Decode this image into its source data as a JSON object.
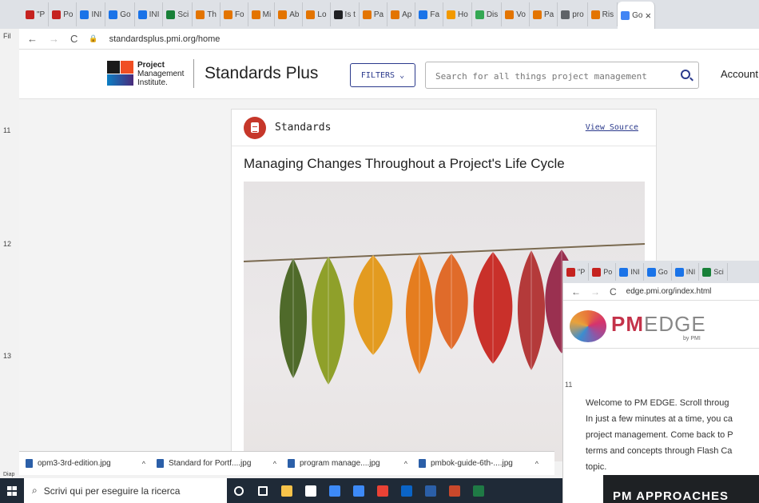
{
  "browser": {
    "url": "standardsplus.pmi.org/home",
    "tabs": [
      "\"P",
      "Po",
      "INI",
      "Go",
      "INI",
      "Sci",
      "Th",
      "Fo",
      "Mi",
      "Ab",
      "Lo",
      "Is t",
      "Pa",
      "Ap",
      "Fa",
      "Ho",
      "Dis",
      "Vo",
      "Pa",
      "pro",
      "Ris",
      "Go"
    ],
    "tab_colors": [
      "#c5221f",
      "#c5221f",
      "#1a73e8",
      "#1a73e8",
      "#1a73e8",
      "#188038",
      "#e37400",
      "#e37400",
      "#e37400",
      "#e37400",
      "#e37400",
      "#202124",
      "#e37400",
      "#e37400",
      "#1a73e8",
      "#f29900",
      "#34a853",
      "#e37400",
      "#e37400",
      "#5f6368",
      "#e37400",
      "#4285f4"
    ]
  },
  "left_labels": [
    "Fil",
    "11",
    "12",
    "13",
    "Diap"
  ],
  "header": {
    "logo_line1": "Project",
    "logo_line2": "Management",
    "logo_line3": "Institute.",
    "brand": "Standards Plus",
    "filters_label": "FILTERS",
    "search_placeholder": "Search for all things project management",
    "account": "Account"
  },
  "card": {
    "category": "Standards",
    "view_source": "View Source",
    "title": "Managing Changes Throughout a Project's Life Cycle",
    "leaf_colors": [
      "#4f6a2a",
      "#8fa02a",
      "#e39b20",
      "#e57d1f",
      "#e06b2a",
      "#c9302a",
      "#b43a3a",
      "#9a3050"
    ]
  },
  "downloads": [
    {
      "name": "opm3-3rd-edition.jpg"
    },
    {
      "name": "Standard for Portf....jpg"
    },
    {
      "name": "program manage....jpg"
    },
    {
      "name": "pmbok-guide-6th-....jpg"
    }
  ],
  "taskbar": {
    "search_text": "Scrivi qui per eseguire la ricerca",
    "icons": [
      "cortana-icon",
      "task-view-icon",
      "file-explorer-icon",
      "store-icon",
      "dropbox-icon",
      "mail-icon",
      "chrome-icon",
      "outlook-icon",
      "word-icon",
      "powerpoint-icon",
      "excel-icon"
    ],
    "icon_colors": [
      "#fff",
      "#fff",
      "#f7c34a",
      "#fff",
      "#3d8af7",
      "#3d8af7",
      "#e94235",
      "#0a64c7",
      "#2b5fa8",
      "#c9482b",
      "#1f7a45"
    ]
  },
  "popup": {
    "url": "edge.pmi.org/index.html",
    "tabs": [
      "\"P",
      "Po",
      "INI",
      "Go",
      "INI",
      "Sci"
    ],
    "logo_pm": "PM",
    "logo_edge": "EDGE",
    "by": "by PMI",
    "row_number": "11",
    "welcome": "Welcome to PM EDGE. Scroll through... In just a few minutes at a time, you can... project management. Come back to P... terms and concepts through Flash Ca... topic.",
    "welcome_lines": [
      "Welcome to PM EDGE. Scroll throug",
      "In just a few minutes at a time, you ca",
      "project management. Come back to P",
      "terms and concepts through Flash Ca",
      "topic."
    ],
    "banner": "PM APPROACHES",
    "side": [
      "S",
      "Fil"
    ]
  }
}
